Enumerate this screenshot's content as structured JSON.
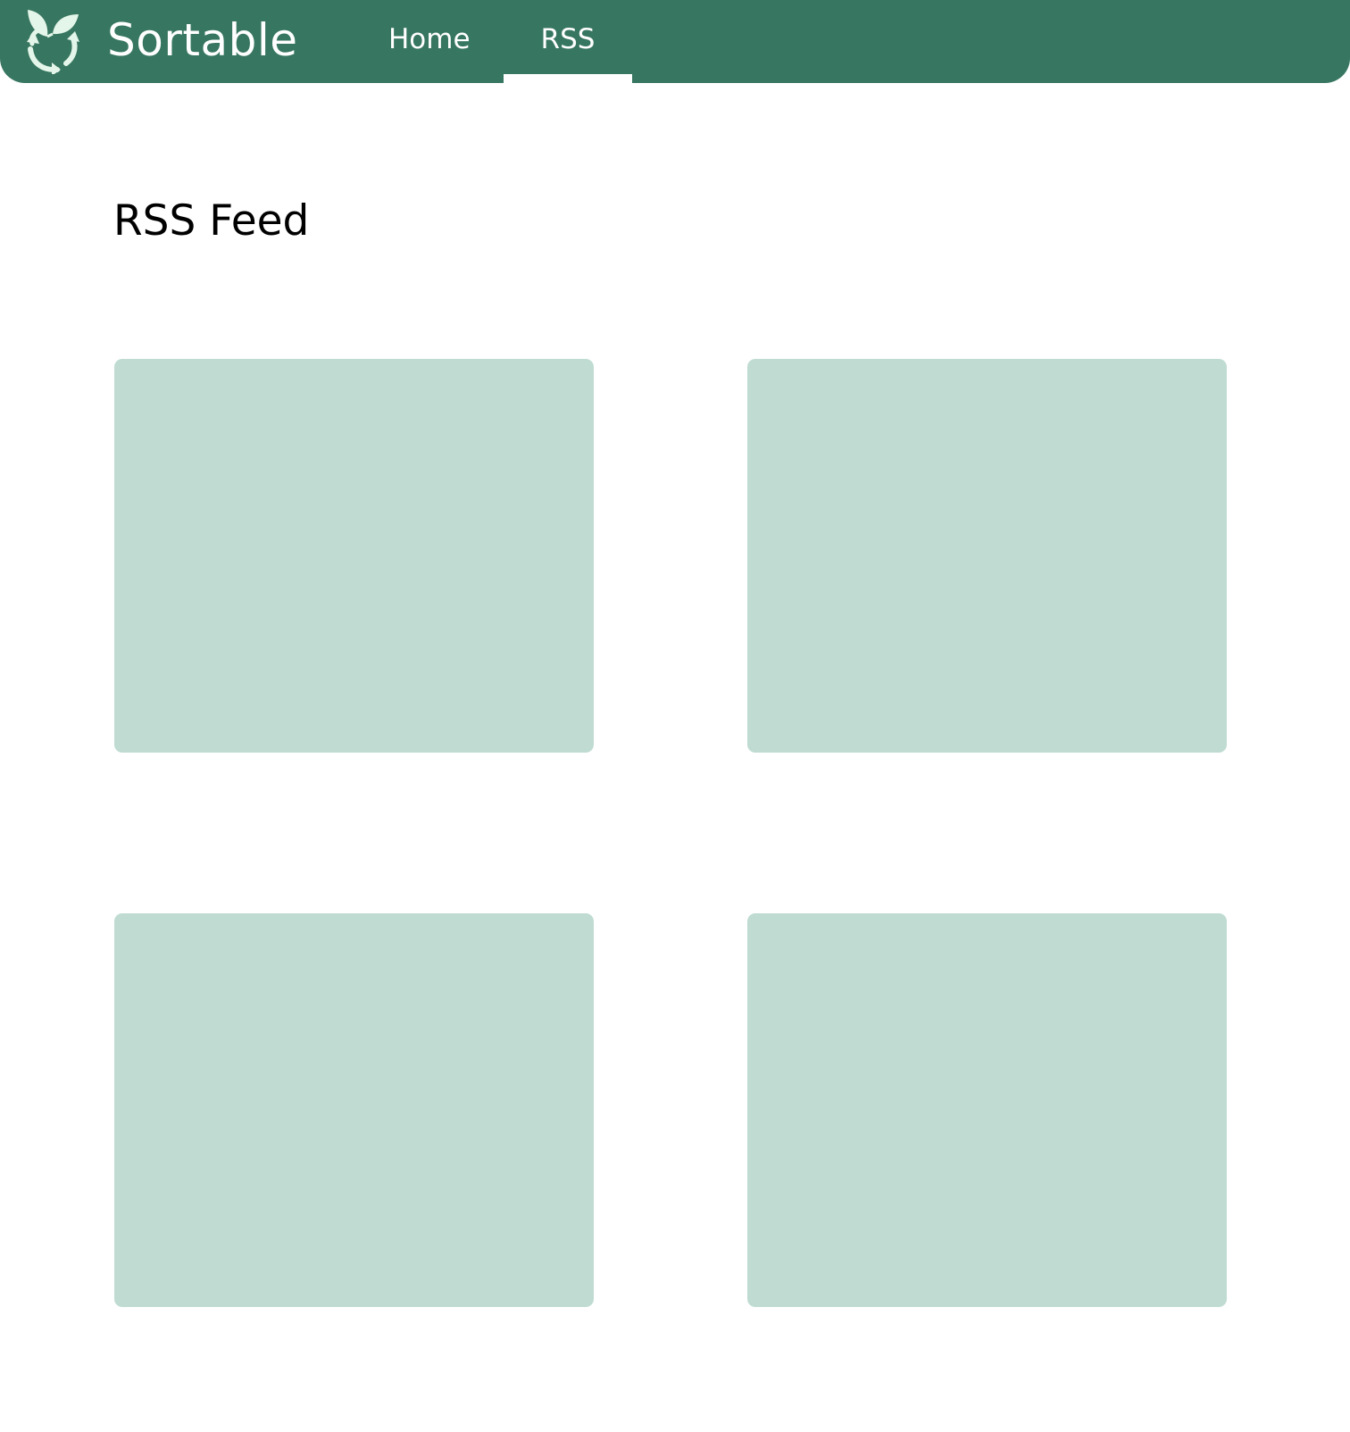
{
  "header": {
    "brand": "Sortable",
    "logo_icon": "leaf-recycle-icon",
    "background_color": "#377660",
    "nav": [
      {
        "label": "Home",
        "active": false
      },
      {
        "label": "RSS",
        "active": true
      }
    ]
  },
  "main": {
    "title": "RSS Feed",
    "card_color": "#bfdbd2",
    "cards": [
      {},
      {},
      {},
      {}
    ]
  }
}
